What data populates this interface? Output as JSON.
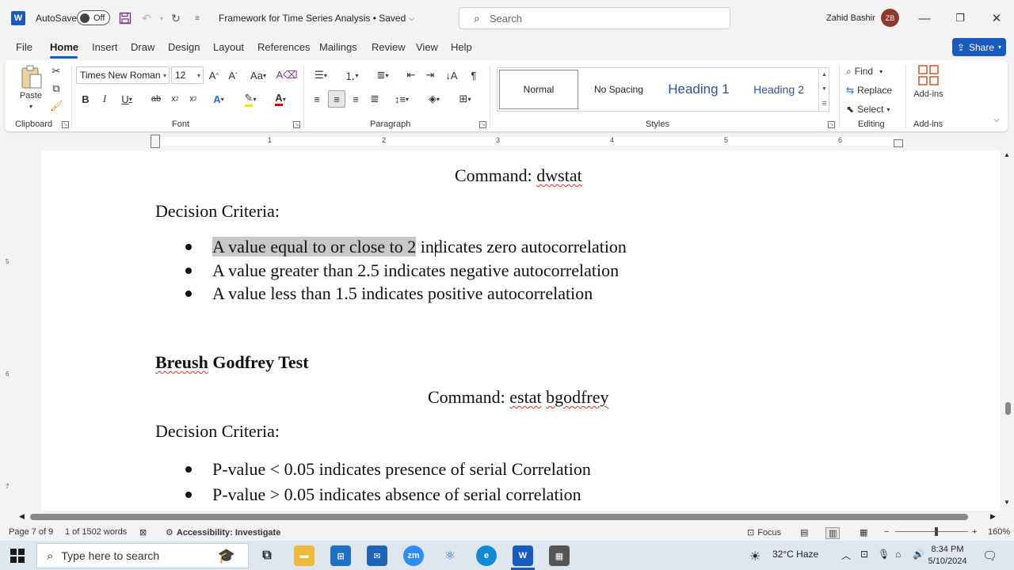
{
  "titlebar": {
    "autosave_label": "AutoSave",
    "autosave_state": "Off",
    "doc_title": "Framework for Time Series Analysis • Saved",
    "search_placeholder": "Search",
    "user_name": "Zahid Bashir",
    "user_initials": "ZB"
  },
  "menu": {
    "tabs": [
      "File",
      "Home",
      "Insert",
      "Draw",
      "Design",
      "Layout",
      "References",
      "Mailings",
      "Review",
      "View",
      "Help"
    ],
    "share_label": "Share"
  },
  "ribbon": {
    "clipboard": {
      "paste_label": "Paste",
      "group_label": "Clipboard"
    },
    "font": {
      "font_name": "Times New Roman",
      "font_size": "12",
      "group_label": "Font"
    },
    "paragraph": {
      "group_label": "Paragraph"
    },
    "styles": {
      "items": [
        "Normal",
        "No Spacing",
        "Heading 1",
        "Heading 2"
      ],
      "group_label": "Styles"
    },
    "editing": {
      "find_label": "Find",
      "replace_label": "Replace",
      "select_label": "Select",
      "group_label": "Editing"
    },
    "addins": {
      "label": "Add-ins",
      "group_label": "Add-ins"
    }
  },
  "ruler": {
    "marks": [
      "1",
      "2",
      "3",
      "4",
      "5",
      "6"
    ]
  },
  "vruler": {
    "marks": [
      "5",
      "6",
      "7"
    ]
  },
  "document": {
    "command1": "Command:  ",
    "command1_value": "dwstat",
    "decision1": "Decision Criteria:",
    "bullets1": {
      "b1_highlighted": "A value equal to or close to 2",
      "b1_rest": " indicates zero autocorrelation",
      "b2": "A value greater than 2.5 indicates negative autocorrelation",
      "b3": "A value less than 1.5 indicates positive autocorrelation"
    },
    "heading_part1": "Breush",
    "heading_part2": " Godfrey Test",
    "command2": "Command: ",
    "command2_value1": "estat",
    "command2_value2": "bgodfrey",
    "decision2": "Decision Criteria:",
    "bullets2": {
      "b1": "P-value < 0.05 indicates presence of serial Correlation",
      "b2": "P-value > 0.05 indicates absence of serial correlation"
    }
  },
  "status": {
    "page": "Page 7 of 9",
    "words": "1 of 1502 words",
    "accessibility": "Accessibility: Investigate",
    "focus": "Focus",
    "zoom": "160%"
  },
  "taskbar": {
    "search_placeholder": "Type here to search",
    "weather": "32°C  Haze",
    "time": "8:34 PM",
    "date": "5/10/2024"
  },
  "colors": {
    "accent": "#185abd",
    "heading": "#2f5496",
    "highlight": "#c8c8c8"
  }
}
